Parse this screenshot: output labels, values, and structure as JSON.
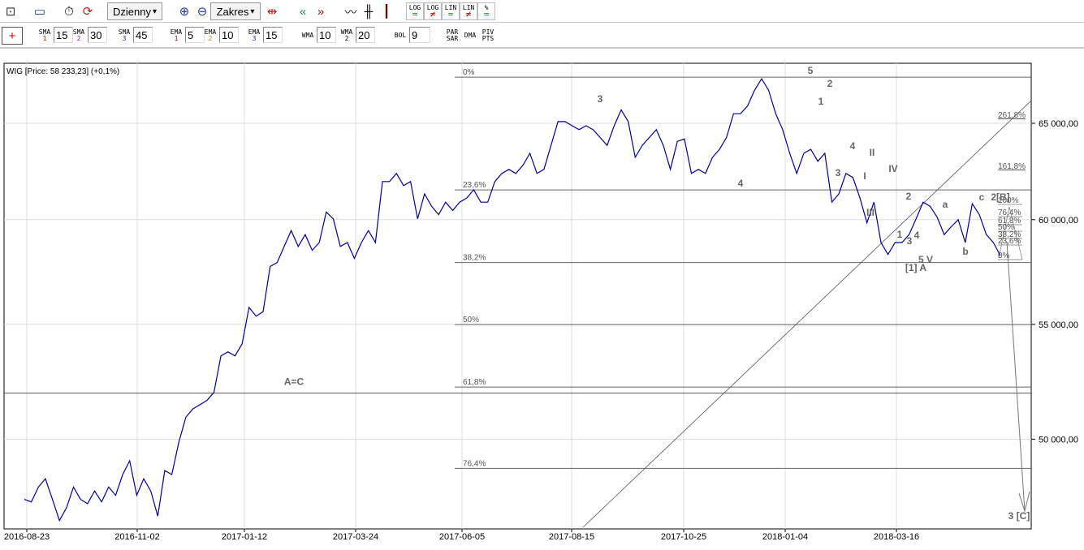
{
  "toolbar1": {
    "period": "Dzienny",
    "range": "Zakres",
    "icons": [
      "chart-settings-icon",
      "window-icon",
      "timer-icon",
      "refresh-icon",
      "zoom-in-icon",
      "zoom-out-icon",
      "fit-range-icon",
      "scroll-left-icon",
      "scroll-right-icon",
      "line-chart-icon",
      "bar-chart-icon",
      "candlestick-icon"
    ],
    "scale": [
      {
        "top": "LOG",
        "bot": "="
      },
      {
        "top": "LOG",
        "bot": "≠"
      },
      {
        "top": "LIN",
        "bot": "="
      },
      {
        "top": "LIN",
        "bot": "≠"
      },
      {
        "top": "%",
        "bot": "="
      }
    ]
  },
  "toolbar2": {
    "indicators": [
      {
        "name": "SMA",
        "num": "1",
        "value": "15",
        "color": "#c00000"
      },
      {
        "name": "SMA",
        "num": "2",
        "value": "30",
        "color": "#a020a0"
      },
      {
        "name": "SMA",
        "num": "3",
        "value": "45",
        "color": "#2020a0"
      },
      {
        "name": "EMA",
        "num": "1",
        "value": "5",
        "color": "#c00000"
      },
      {
        "name": "EMA",
        "num": "2",
        "value": "10",
        "color": "#d08000"
      },
      {
        "name": "EMA",
        "num": "3",
        "value": "15",
        "color": "#2020a0"
      },
      {
        "name": "WMA",
        "num": "",
        "value": "10",
        "color": "#000"
      },
      {
        "name": "WMA",
        "num": "2",
        "value": "20",
        "color": "#000"
      },
      {
        "name": "BOL",
        "num": "",
        "value": "9",
        "color": "#000"
      }
    ],
    "extra": [
      {
        "top": "PAR",
        "bot": "SAR"
      },
      {
        "top": "DMA",
        "bot": ""
      },
      {
        "top": "PIV",
        "bot": "PTS"
      }
    ]
  },
  "chart_header": "WIG [Price: 58 233,23] (+0,1%)",
  "chart_data": {
    "type": "line",
    "title": "WIG [Price: 58 233,23] (+0,1%)",
    "x_tick_labels": [
      "2016-08-23",
      "2016-11-02",
      "2017-01-12",
      "2017-03-24",
      "2017-06-05",
      "2017-08-15",
      "2017-10-25",
      "2018-01-04",
      "2018-03-16"
    ],
    "y_tick_labels": [
      "65 000,00",
      "60 000,00",
      "55 000,00",
      "50 000,00"
    ],
    "y_ticks": [
      65000,
      60000,
      55000,
      50000
    ],
    "y_scale": "log",
    "series": [
      {
        "name": "WIG",
        "color": "#0000a0",
        "values": [
          47560,
          47460,
          48050,
          48380,
          47560,
          46730,
          47230,
          48050,
          47560,
          47390,
          47890,
          47460,
          48050,
          47720,
          48550,
          49110,
          47720,
          48380,
          47890,
          46900,
          48710,
          48550,
          49870,
          50920,
          51270,
          51450,
          51630,
          51980,
          53580,
          53760,
          53580,
          54110,
          55780,
          55380,
          55580,
          57710,
          57900,
          58680,
          59460,
          58680,
          59260,
          58490,
          58870,
          60380,
          60040,
          58680,
          58870,
          58100,
          58870,
          59460,
          58870,
          61930,
          61930,
          62350,
          61720,
          61930,
          60040,
          61300,
          60670,
          60250,
          60880,
          60460,
          60880,
          61090,
          61510,
          60880,
          60880,
          61930,
          62350,
          62560,
          62350,
          62770,
          63400,
          62350,
          62560,
          63820,
          65090,
          65090,
          64870,
          64660,
          64870,
          64660,
          64240,
          63820,
          64870,
          65730,
          65090,
          63190,
          63820,
          64240,
          64660,
          63820,
          62560,
          64030,
          64160,
          62350,
          62560,
          62350,
          63190,
          63610,
          64240,
          65520,
          65520,
          65950,
          66810,
          67450,
          66810,
          65520,
          64660,
          63400,
          62350,
          63400,
          63610,
          62980,
          63400,
          60880,
          61300,
          62350,
          62140,
          61090,
          59840,
          60880,
          58870,
          58290,
          58870,
          58870,
          59260,
          60040,
          60880,
          60670,
          60120,
          59260,
          59650,
          60000,
          58870,
          60800,
          60250,
          59260,
          58870,
          58233
        ]
      }
    ],
    "fib_levels": [
      {
        "label": "0%",
        "value": 67540
      },
      {
        "label": "23,6%",
        "value": 61500
      },
      {
        "label": "38,2%",
        "value": 57900
      },
      {
        "label": "50%",
        "value": 54990
      },
      {
        "label": "61,8%",
        "value": 52210
      },
      {
        "label": "76,4%",
        "value": 48800
      }
    ],
    "horizontal_line": {
      "label": "A=C",
      "value": 51950
    },
    "extension_labels": [
      "261,8%",
      "161,8%"
    ],
    "small_fib_labels": [
      "100%",
      "76,4%",
      "61,8%",
      "50%",
      "38,2%",
      "23,6%",
      "0%"
    ],
    "wave_labels": [
      "3",
      "4",
      "5",
      "2",
      "1",
      "3",
      "4",
      "II",
      "I",
      "IV",
      "III",
      "2",
      "1",
      "3",
      "4",
      "5 V",
      "[1] A",
      "a",
      "b",
      "c",
      "2[B]",
      "3 [C]"
    ]
  }
}
